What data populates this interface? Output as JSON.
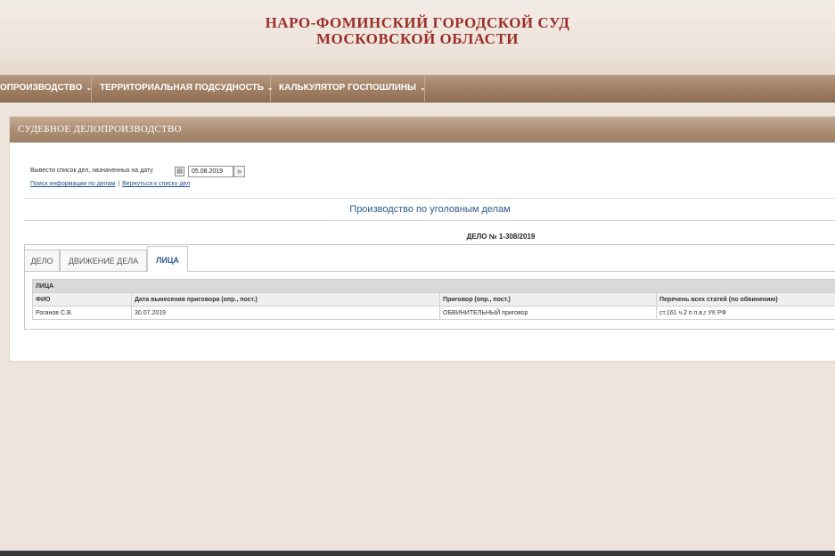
{
  "header": {
    "title_line1": "НАРО-ФОМИНСКИЙ ГОРОДСКОЙ СУД",
    "title_line2": "МОСКОВСКОЙ ОБЛАСТИ"
  },
  "nav": {
    "items": [
      {
        "label": "ОПРОИЗВОДСТВО"
      },
      {
        "label": "ТЕРРИТОРИАЛЬНАЯ ПОДСУДНОСТЬ"
      },
      {
        "label": "КАЛЬКУЛЯТОР ГОСПОШЛИНЫ"
      }
    ]
  },
  "panel": {
    "title": "СУДЕБНОЕ ДЕЛОПРОИЗВОДСТВО",
    "date_label": "Вывести список дел, назначенных на дату",
    "date_value": "05.08.2019",
    "link_search": "Поиск информации по делам",
    "link_separator": "|",
    "link_back": "Вернуться к списку дел",
    "section_title": "Производство по уголовным делам",
    "case_number": "ДЕЛО № 1-308/2019"
  },
  "tabs": [
    {
      "label": "ДЕЛО"
    },
    {
      "label": "ДВИЖЕНИЕ ДЕЛА"
    },
    {
      "label": "ЛИЦА"
    }
  ],
  "table": {
    "caption": "ЛИЦА",
    "columns": [
      "ФИО",
      "Дата вынесения приговора (опр., пост.)",
      "Приговор (опр., пост.)",
      "Перечень всех статей (по обвинению)"
    ],
    "rows": [
      [
        "Роганов С.В.",
        "30.07.2019",
        "ОБВИНИТЕЛЬНЫЙ приговор",
        "ст.161 ч.2 п.п.в,г УК РФ"
      ]
    ]
  },
  "colors": {
    "title_red": "#9a2f2a",
    "nav_brown": "#a07f63",
    "link_blue": "#2a4f88",
    "section_blue": "#2f5b8a"
  }
}
